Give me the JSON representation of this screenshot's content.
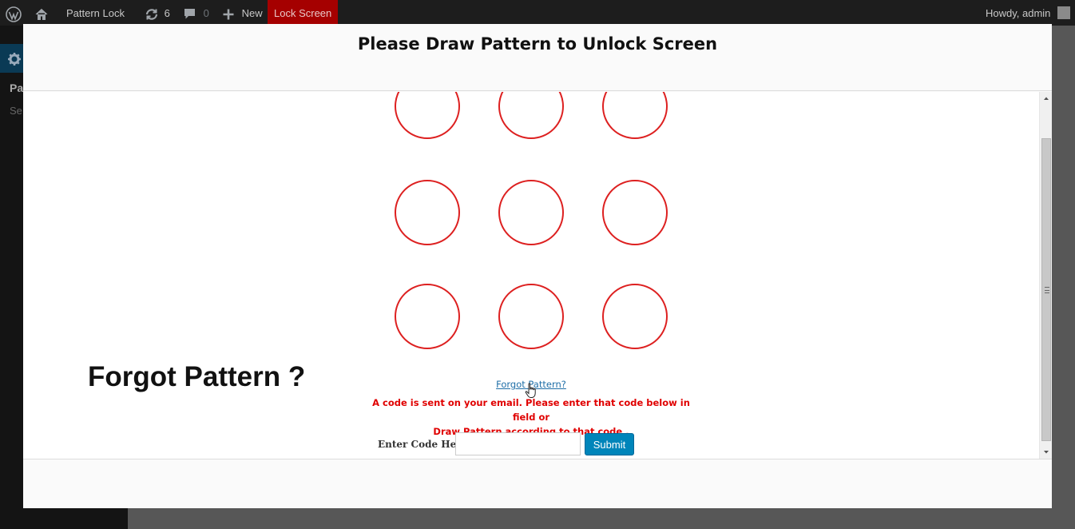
{
  "admin_bar": {
    "site_name": "Pattern Lock",
    "updates_count": "6",
    "comments_count": "0",
    "new_label": "New",
    "lock_screen_label": "Lock Screen",
    "greeting": "Howdy, admin"
  },
  "background": {
    "sidebar_label_1": "Pa",
    "sidebar_label_2": "Se"
  },
  "modal": {
    "title": "Please Draw Pattern to Unlock Screen",
    "forgot_heading": "Forgot Pattern ?",
    "forgot_link": "Forgot Pattern?",
    "code_message_line1": "A code is sent on your email. Please enter that code below in field or",
    "code_message_line2": "Draw Pattern according to that code .",
    "code_label": "Enter Code Here",
    "code_input_value": "",
    "submit_label": "Submit"
  },
  "pattern": {
    "rows": 3,
    "cols": 3,
    "dots": [
      "1",
      "2",
      "3",
      "4",
      "5",
      "6",
      "7",
      "8",
      "9"
    ]
  },
  "colors": {
    "accent_red": "#dd2020",
    "message_red": "#e00000",
    "link_blue": "#1e6ea7",
    "button_blue": "#0085ba",
    "admin_bar_bg": "#1d1d1d",
    "lock_screen_bg": "#a50000"
  },
  "icons": [
    "wordpress-logo-icon",
    "home-icon",
    "updates-icon",
    "comments-icon",
    "plus-icon",
    "avatar-icon",
    "gear-icon",
    "hand-cursor-icon",
    "scroll-up-icon",
    "scroll-down-icon"
  ]
}
